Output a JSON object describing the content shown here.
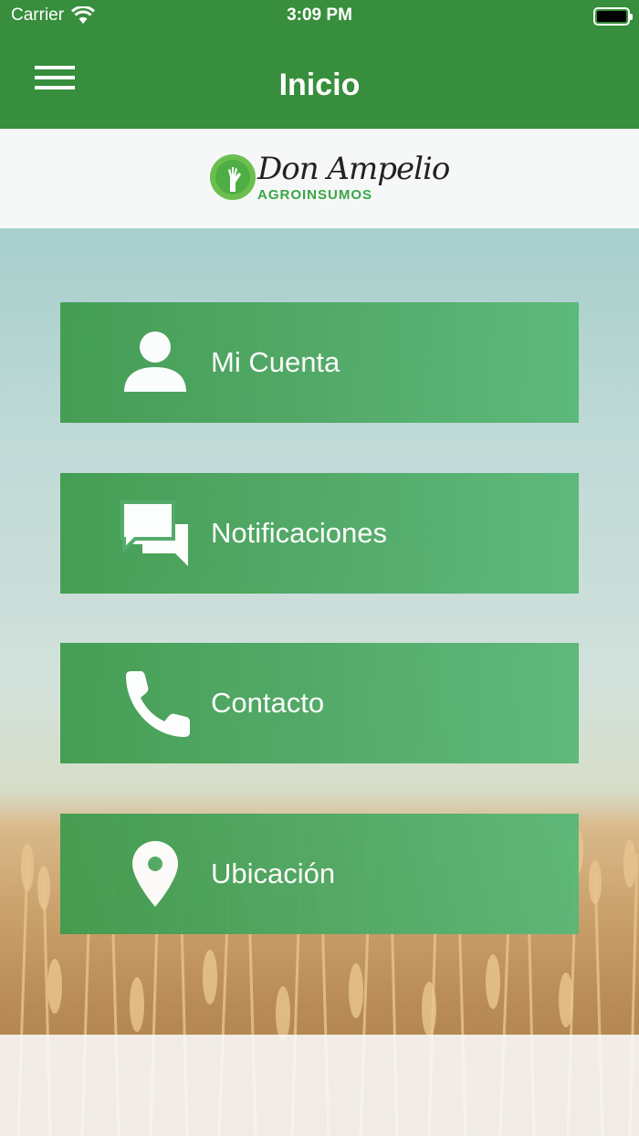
{
  "status_bar": {
    "carrier": "Carrier",
    "time": "3:09 PM",
    "wifi_icon": "wifi-icon",
    "battery_level": 1.0
  },
  "nav": {
    "title": "Inicio",
    "menu_icon": "hamburger-menu-icon"
  },
  "logo": {
    "name": "Don Ampelio",
    "subtitle": "AGROINSUMOS"
  },
  "menu": [
    {
      "label": "Mi Cuenta",
      "icon": "user-icon"
    },
    {
      "label": "Notificaciones",
      "icon": "chat-bubbles-icon"
    },
    {
      "label": "Contacto",
      "icon": "phone-icon"
    },
    {
      "label": "Ubicación",
      "icon": "location-pin-icon"
    }
  ],
  "colors": {
    "header": "#378e3c",
    "button": "#4fa965",
    "brand_green": "#3aa547"
  }
}
